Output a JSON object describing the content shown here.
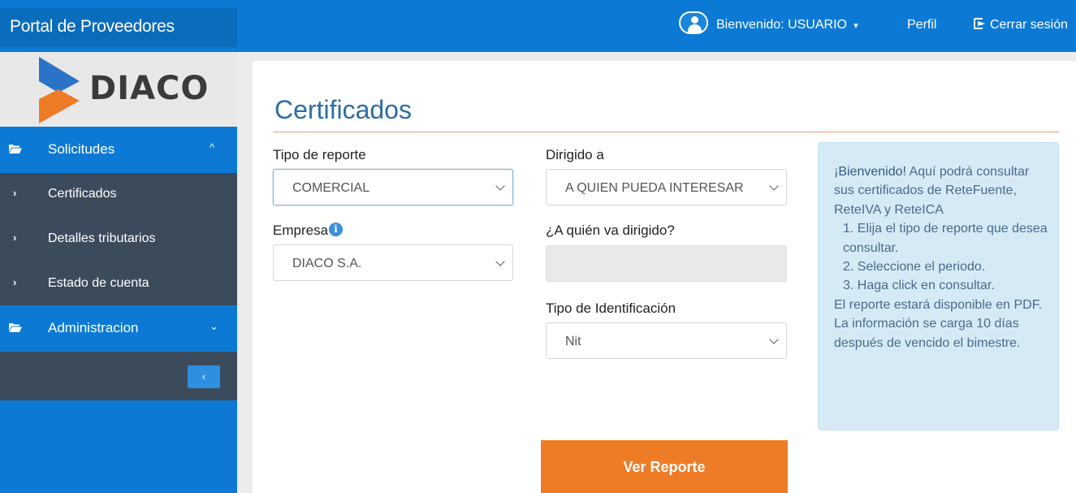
{
  "header": {
    "brand": "Portal de Proveedores",
    "welcome": "Bienvenido: USUARIO",
    "profile_link": "Perfil",
    "logout_link": "Cerrar sesión"
  },
  "sidebar": {
    "logo_text": "DIACO",
    "logo_colors": {
      "blue": "#2a73c9",
      "orange": "#ee7c26"
    },
    "sections": [
      {
        "label": "Solicitudes",
        "expanded": true,
        "items": [
          {
            "label": "Certificados"
          },
          {
            "label": "Detalles tributarios"
          },
          {
            "label": "Estado de cuenta"
          }
        ]
      },
      {
        "label": "Administracion",
        "expanded": false
      }
    ],
    "collapse_glyph": "‹"
  },
  "main": {
    "title": "Certificados",
    "form": {
      "report_type": {
        "label": "Tipo de reporte",
        "value": "COMERCIAL"
      },
      "addressed_to": {
        "label": "Dirigido a",
        "value": "A QUIEN PUEDA INTERESAR"
      },
      "company": {
        "label": "Empresa",
        "value": "DIACO S.A."
      },
      "addressee_name": {
        "label": "¿A quién va dirigido?",
        "value": ""
      },
      "id_type": {
        "label": "Tipo de Identificación",
        "value": "Nit"
      }
    },
    "info": {
      "strong": "¡Bienvenido!",
      "intro": " Aquí podrá consultar sus certificados de ReteFuente, ReteIVA y ReteICA",
      "steps": [
        "1. Elija el tipo de reporte que desea consultar.",
        "2. Seleccione el periodo.",
        "3. Haga click en consultar."
      ],
      "note1": "El reporte estará disponible en PDF.",
      "note2": "La información se carga 10 días después de vencido el bimestre."
    },
    "submit_label": "Ver Reporte"
  },
  "colors": {
    "primary": "#0c7ad4",
    "sidebar_dark": "#3c4b5c",
    "accent": "#ee7c26",
    "title": "#2b6ea5",
    "info_bg": "#d6eaf6"
  }
}
